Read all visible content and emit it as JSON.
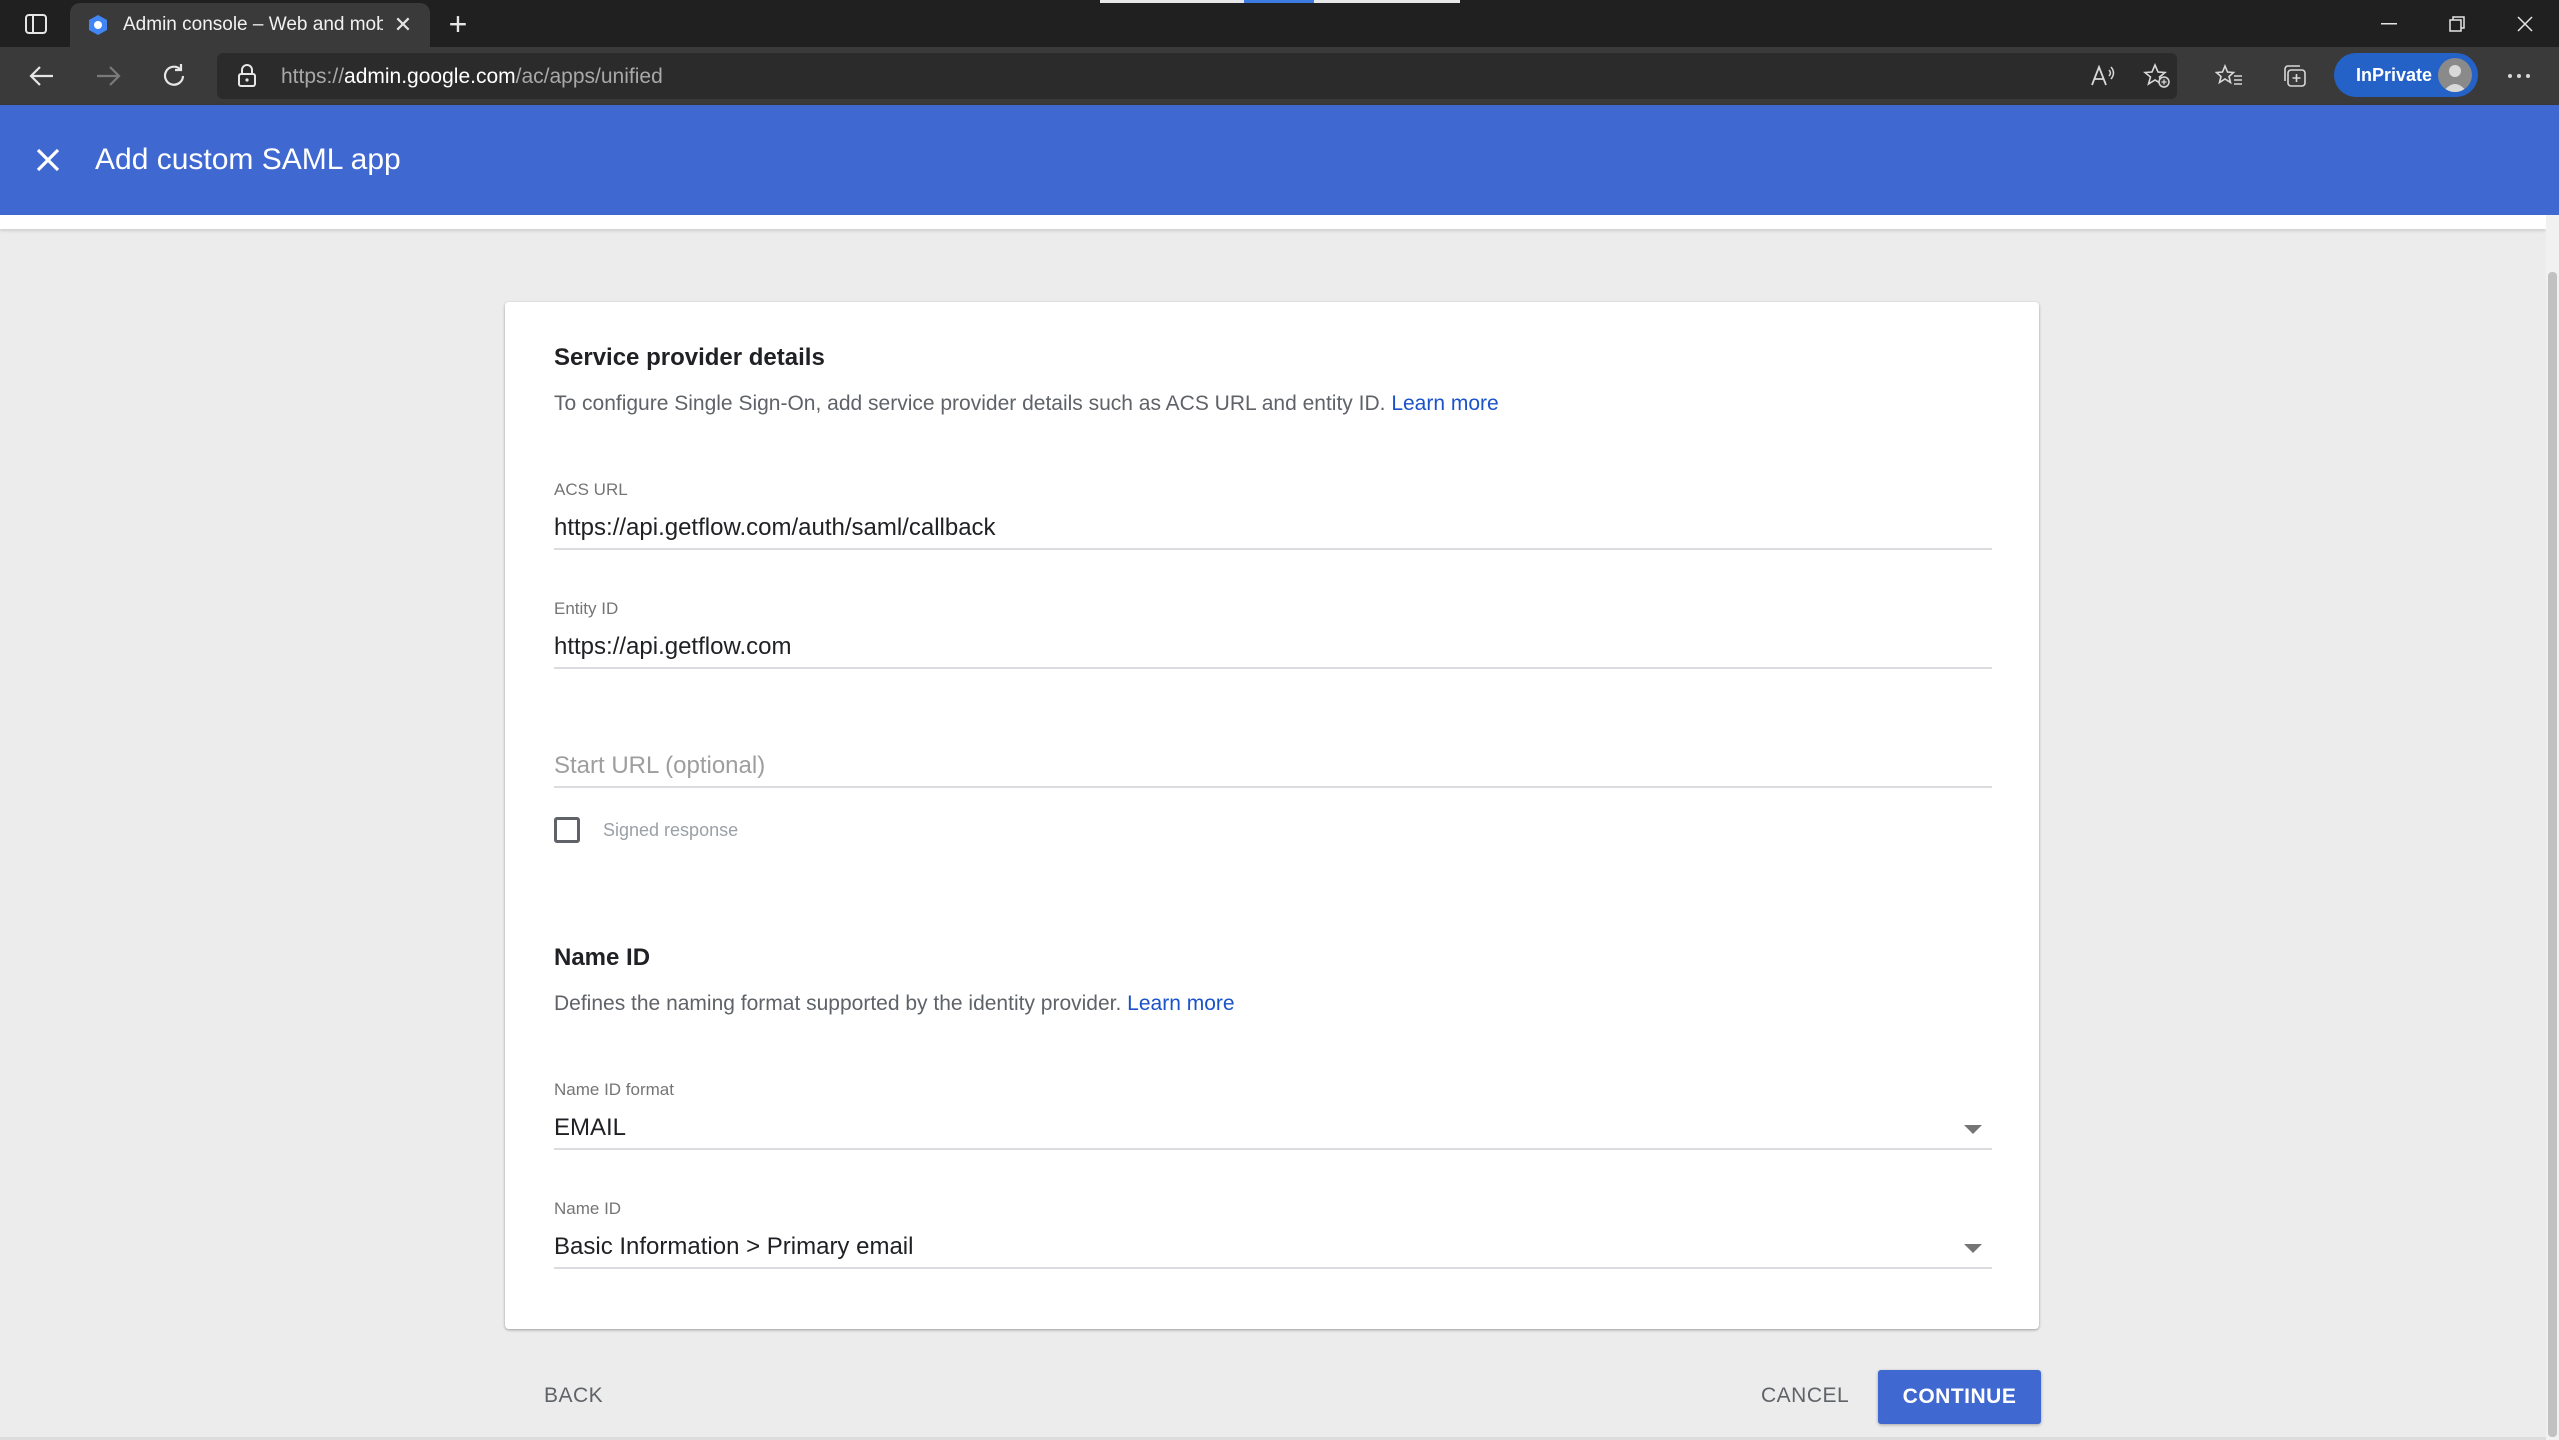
{
  "browser": {
    "tab_title": "Admin console – Web and mobil",
    "tab_close": "✕",
    "new_tab": "+",
    "url_prefix": "https://",
    "url_host": "admin.google.com",
    "url_path": "/ac/apps/unified",
    "inprivate_label": "InPrivate",
    "window_controls": [
      "minimize",
      "restore",
      "close"
    ]
  },
  "header": {
    "title": "Add custom SAML app",
    "close_icon": "close-icon",
    "color": "#3f68d1"
  },
  "service_provider": {
    "title": "Service provider details",
    "description": "To configure Single Sign-On, add service provider details such as ACS URL and entity ID.",
    "learn_more": "Learn more",
    "acs_url": {
      "label": "ACS URL",
      "value": "https://api.getflow.com/auth/saml/callback"
    },
    "entity_id": {
      "label": "Entity ID",
      "value": "https://api.getflow.com"
    },
    "start_url": {
      "placeholder": "Start URL (optional)"
    },
    "signed_response": {
      "label": "Signed response",
      "checked": false
    }
  },
  "name_id": {
    "title": "Name ID",
    "description": "Defines the naming format supported by the identity provider.",
    "learn_more": "Learn more",
    "format": {
      "label": "Name ID format",
      "value": "EMAIL"
    },
    "name_id_field": {
      "label": "Name ID",
      "value": "Basic Information > Primary email"
    }
  },
  "footer": {
    "back": "BACK",
    "cancel": "CANCEL",
    "continue": "CONTINUE"
  }
}
